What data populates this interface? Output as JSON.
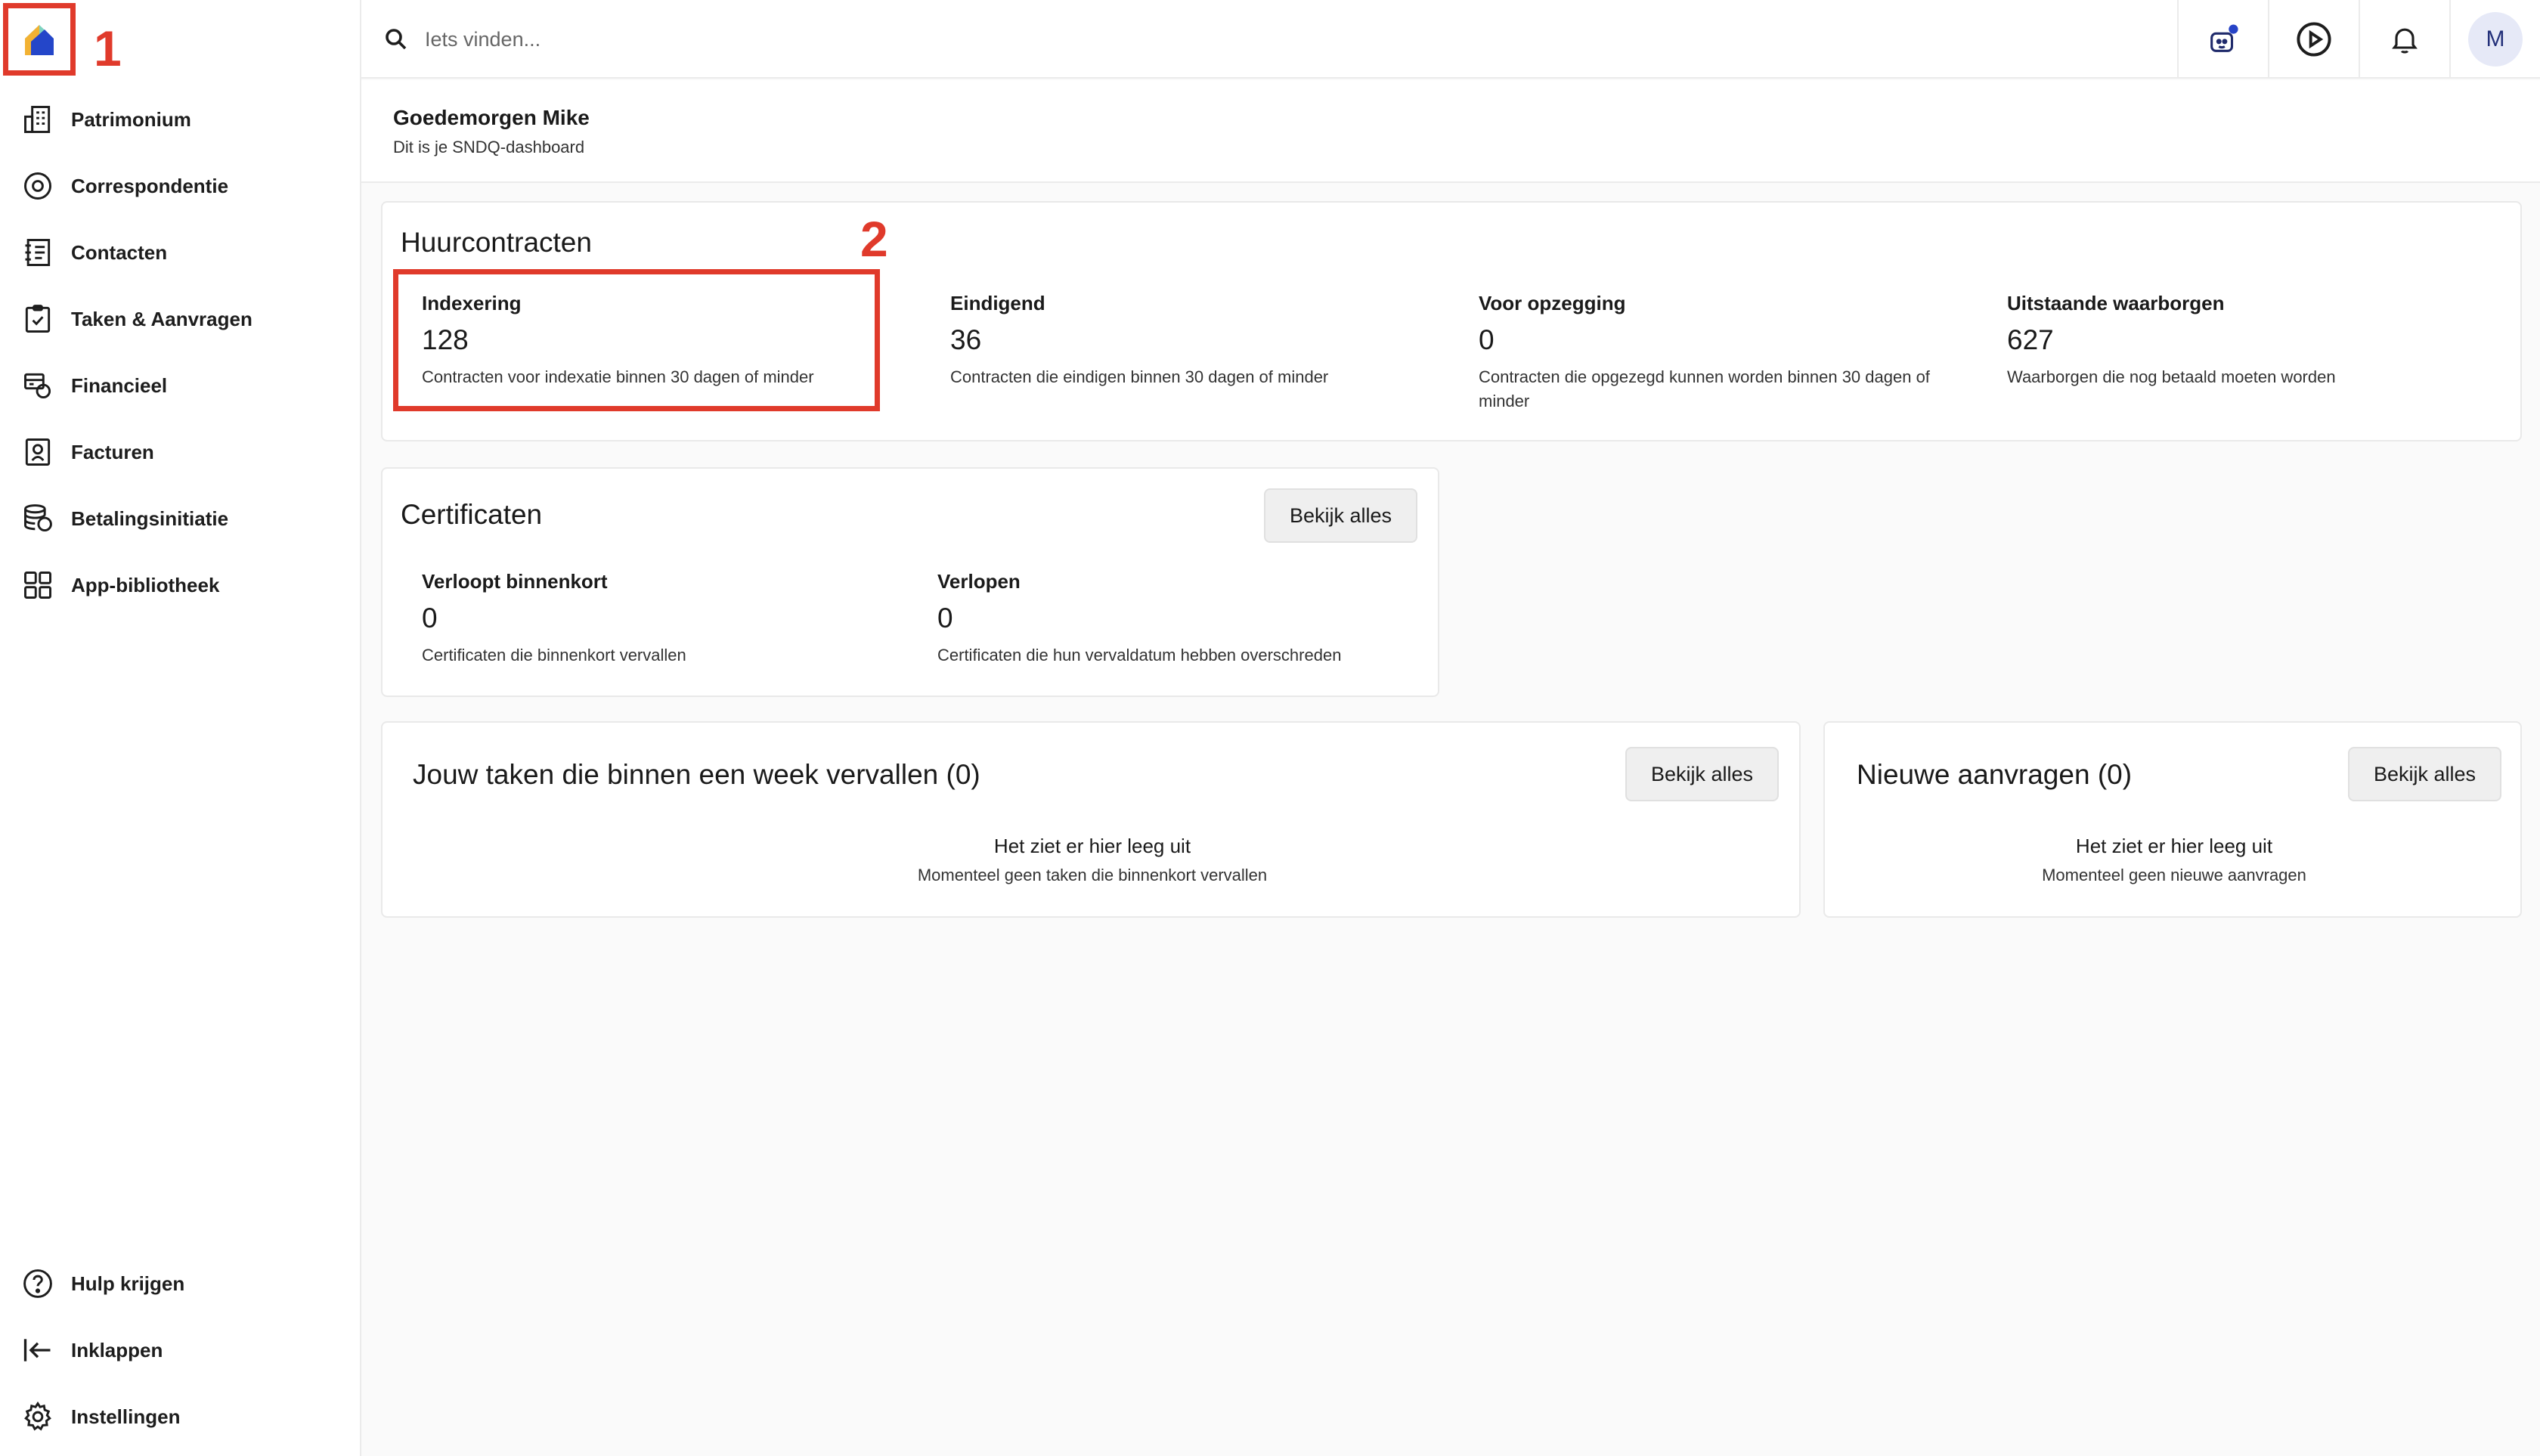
{
  "search": {
    "placeholder": "Iets vinden..."
  },
  "user": {
    "initial": "M"
  },
  "annotations": {
    "one": "1",
    "two": "2"
  },
  "sidebar": {
    "items": [
      {
        "label": "Patrimonium",
        "icon": "building-icon"
      },
      {
        "label": "Correspondentie",
        "icon": "message-circle-icon"
      },
      {
        "label": "Contacten",
        "icon": "contacts-book-icon"
      },
      {
        "label": "Taken & Aanvragen",
        "icon": "clipboard-check-icon"
      },
      {
        "label": "Financieel",
        "icon": "finance-icon"
      },
      {
        "label": "Facturen",
        "icon": "invoice-icon"
      },
      {
        "label": "Betalingsinitiatie",
        "icon": "coins-stack-icon"
      },
      {
        "label": "App-bibliotheek",
        "icon": "grid-icon"
      }
    ],
    "bottom": [
      {
        "label": "Hulp krijgen",
        "icon": "help-circle-icon"
      },
      {
        "label": "Inklappen",
        "icon": "collapse-left-icon"
      },
      {
        "label": "Instellingen",
        "icon": "settings-gear-icon"
      }
    ]
  },
  "greeting": {
    "title": "Goedemorgen Mike",
    "subtitle": "Dit is je SNDQ-dashboard"
  },
  "huurcontracten": {
    "title": "Huurcontracten",
    "stats": [
      {
        "label": "Indexering",
        "value": "128",
        "desc": "Contracten voor indexatie binnen 30 dagen of minder"
      },
      {
        "label": "Eindigend",
        "value": "36",
        "desc": "Contracten die eindigen binnen 30 dagen of minder"
      },
      {
        "label": "Voor opzegging",
        "value": "0",
        "desc": "Contracten die opgezegd kunnen worden binnen 30 dagen of minder"
      },
      {
        "label": "Uitstaande waarborgen",
        "value": "627",
        "desc": "Waarborgen die nog betaald moeten worden"
      }
    ]
  },
  "certificaten": {
    "title": "Certificaten",
    "button": "Bekijk alles",
    "stats": [
      {
        "label": "Verloopt binnenkort",
        "value": "0",
        "desc": "Certificaten die binnenkort vervallen"
      },
      {
        "label": "Verlopen",
        "value": "0",
        "desc": "Certificaten die hun vervaldatum hebben overschreden"
      }
    ]
  },
  "taken": {
    "title": "Jouw taken die binnen een week vervallen (0)",
    "button": "Bekijk alles",
    "empty_title": "Het ziet er hier leeg uit",
    "empty_sub": "Momenteel geen taken die binnenkort vervallen"
  },
  "aanvragen": {
    "title": "Nieuwe aanvragen (0)",
    "button": "Bekijk alles",
    "empty_title": "Het ziet er hier leeg uit",
    "empty_sub": "Momenteel geen nieuwe aanvragen"
  }
}
